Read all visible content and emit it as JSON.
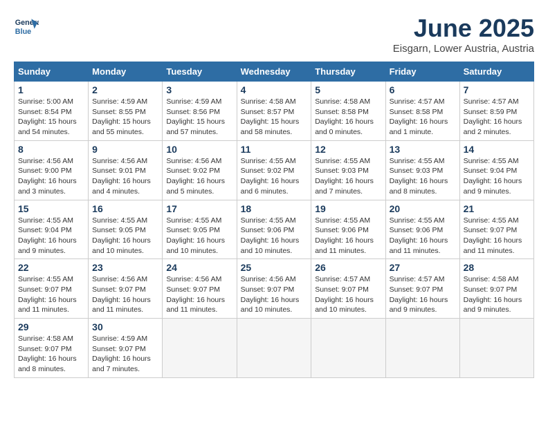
{
  "header": {
    "logo_line1": "General",
    "logo_line2": "Blue",
    "month": "June 2025",
    "location": "Eisgarn, Lower Austria, Austria"
  },
  "days_of_week": [
    "Sunday",
    "Monday",
    "Tuesday",
    "Wednesday",
    "Thursday",
    "Friday",
    "Saturday"
  ],
  "weeks": [
    [
      {
        "day": "1",
        "info": "Sunrise: 5:00 AM\nSunset: 8:54 PM\nDaylight: 15 hours\nand 54 minutes."
      },
      {
        "day": "2",
        "info": "Sunrise: 4:59 AM\nSunset: 8:55 PM\nDaylight: 15 hours\nand 55 minutes."
      },
      {
        "day": "3",
        "info": "Sunrise: 4:59 AM\nSunset: 8:56 PM\nDaylight: 15 hours\nand 57 minutes."
      },
      {
        "day": "4",
        "info": "Sunrise: 4:58 AM\nSunset: 8:57 PM\nDaylight: 15 hours\nand 58 minutes."
      },
      {
        "day": "5",
        "info": "Sunrise: 4:58 AM\nSunset: 8:58 PM\nDaylight: 16 hours\nand 0 minutes."
      },
      {
        "day": "6",
        "info": "Sunrise: 4:57 AM\nSunset: 8:58 PM\nDaylight: 16 hours\nand 1 minute."
      },
      {
        "day": "7",
        "info": "Sunrise: 4:57 AM\nSunset: 8:59 PM\nDaylight: 16 hours\nand 2 minutes."
      }
    ],
    [
      {
        "day": "8",
        "info": "Sunrise: 4:56 AM\nSunset: 9:00 PM\nDaylight: 16 hours\nand 3 minutes."
      },
      {
        "day": "9",
        "info": "Sunrise: 4:56 AM\nSunset: 9:01 PM\nDaylight: 16 hours\nand 4 minutes."
      },
      {
        "day": "10",
        "info": "Sunrise: 4:56 AM\nSunset: 9:02 PM\nDaylight: 16 hours\nand 5 minutes."
      },
      {
        "day": "11",
        "info": "Sunrise: 4:55 AM\nSunset: 9:02 PM\nDaylight: 16 hours\nand 6 minutes."
      },
      {
        "day": "12",
        "info": "Sunrise: 4:55 AM\nSunset: 9:03 PM\nDaylight: 16 hours\nand 7 minutes."
      },
      {
        "day": "13",
        "info": "Sunrise: 4:55 AM\nSunset: 9:03 PM\nDaylight: 16 hours\nand 8 minutes."
      },
      {
        "day": "14",
        "info": "Sunrise: 4:55 AM\nSunset: 9:04 PM\nDaylight: 16 hours\nand 9 minutes."
      }
    ],
    [
      {
        "day": "15",
        "info": "Sunrise: 4:55 AM\nSunset: 9:04 PM\nDaylight: 16 hours\nand 9 minutes."
      },
      {
        "day": "16",
        "info": "Sunrise: 4:55 AM\nSunset: 9:05 PM\nDaylight: 16 hours\nand 10 minutes."
      },
      {
        "day": "17",
        "info": "Sunrise: 4:55 AM\nSunset: 9:05 PM\nDaylight: 16 hours\nand 10 minutes."
      },
      {
        "day": "18",
        "info": "Sunrise: 4:55 AM\nSunset: 9:06 PM\nDaylight: 16 hours\nand 10 minutes."
      },
      {
        "day": "19",
        "info": "Sunrise: 4:55 AM\nSunset: 9:06 PM\nDaylight: 16 hours\nand 11 minutes."
      },
      {
        "day": "20",
        "info": "Sunrise: 4:55 AM\nSunset: 9:06 PM\nDaylight: 16 hours\nand 11 minutes."
      },
      {
        "day": "21",
        "info": "Sunrise: 4:55 AM\nSunset: 9:07 PM\nDaylight: 16 hours\nand 11 minutes."
      }
    ],
    [
      {
        "day": "22",
        "info": "Sunrise: 4:55 AM\nSunset: 9:07 PM\nDaylight: 16 hours\nand 11 minutes."
      },
      {
        "day": "23",
        "info": "Sunrise: 4:56 AM\nSunset: 9:07 PM\nDaylight: 16 hours\nand 11 minutes."
      },
      {
        "day": "24",
        "info": "Sunrise: 4:56 AM\nSunset: 9:07 PM\nDaylight: 16 hours\nand 11 minutes."
      },
      {
        "day": "25",
        "info": "Sunrise: 4:56 AM\nSunset: 9:07 PM\nDaylight: 16 hours\nand 10 minutes."
      },
      {
        "day": "26",
        "info": "Sunrise: 4:57 AM\nSunset: 9:07 PM\nDaylight: 16 hours\nand 10 minutes."
      },
      {
        "day": "27",
        "info": "Sunrise: 4:57 AM\nSunset: 9:07 PM\nDaylight: 16 hours\nand 9 minutes."
      },
      {
        "day": "28",
        "info": "Sunrise: 4:58 AM\nSunset: 9:07 PM\nDaylight: 16 hours\nand 9 minutes."
      }
    ],
    [
      {
        "day": "29",
        "info": "Sunrise: 4:58 AM\nSunset: 9:07 PM\nDaylight: 16 hours\nand 8 minutes."
      },
      {
        "day": "30",
        "info": "Sunrise: 4:59 AM\nSunset: 9:07 PM\nDaylight: 16 hours\nand 7 minutes."
      },
      {
        "day": "",
        "info": ""
      },
      {
        "day": "",
        "info": ""
      },
      {
        "day": "",
        "info": ""
      },
      {
        "day": "",
        "info": ""
      },
      {
        "day": "",
        "info": ""
      }
    ]
  ]
}
